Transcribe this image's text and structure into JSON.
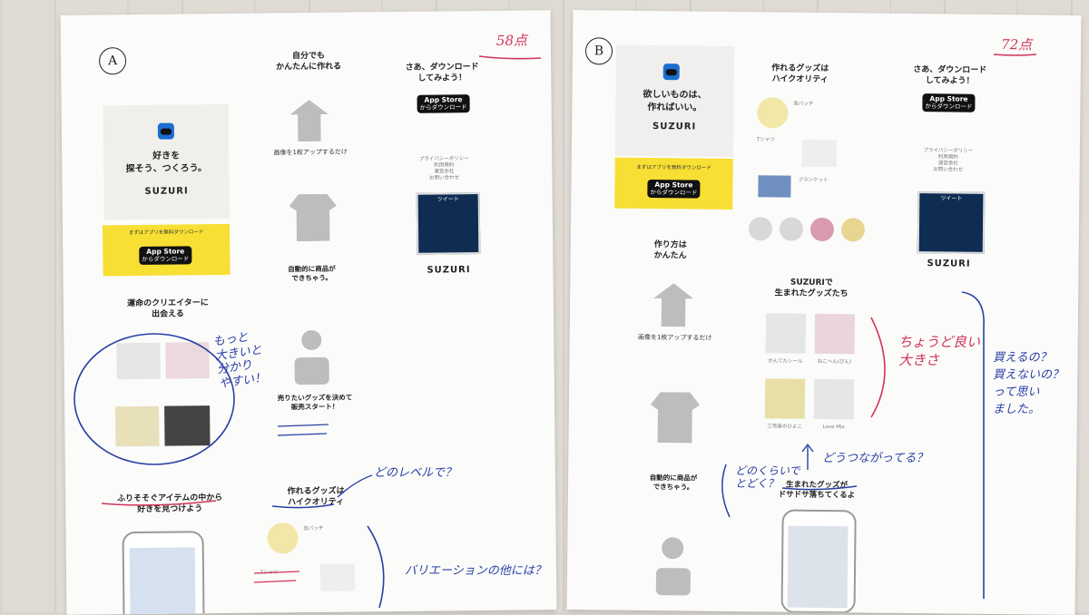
{
  "sheet_a": {
    "label": "A",
    "score": "58点",
    "hero_tagline": "好きを\n探そう、つくろう。",
    "logo": "SUZURI",
    "download_free": "まずはアプリを無料ダウンロード",
    "appstore_line1": "App Store",
    "appstore_line2": "からダウンロード",
    "easy_heading": "自分でも\nかんたんに作れる",
    "step1": "画像を1枚アップするだけ",
    "step2": "自動的に商品が\nできちゃう。",
    "step3": "売りたいグッズを決めて\n販売スタート！",
    "download_heading": "さあ、ダウンロード\nしてみよう！",
    "links": "プライバシーポリシー\n利用規約\n運営会社\nお問い合わせ",
    "tweet_label": "ツイート",
    "creators_heading": "運命のクリエイターに\n出会える",
    "items_heading": "ふりそそぐアイテムの中から\n好きを見つけよう",
    "quality_heading": "作れるグッズは\nハイクオリティ",
    "product1": "缶バッチ",
    "product2": "Tシャツ",
    "note_bigger": "もっと\n大きいと\n分かり\nやすい！",
    "note_level": "どのレベルで？",
    "note_variation": "バリエーションの他には？"
  },
  "sheet_b": {
    "label": "B",
    "score": "72点",
    "hero_tagline": "欲しいものは、\n作ればいい。",
    "logo": "SUZURI",
    "download_free": "まずはアプリを無料ダウンロード",
    "appstore_line1": "App Store",
    "appstore_line2": "からダウンロード",
    "quality_heading": "作れるグッズは\nハイクオリティ",
    "product1": "缶バッチ",
    "product2": "Tシャツ",
    "product3": "ブランケット",
    "download_heading": "さあ、ダウンロード\nしてみよう！",
    "links": "プライバシーポリシー\n利用規約\n運営会社\nお問い合わせ",
    "tweet_label": "ツイート",
    "how_heading": "作り方は\nかんたん",
    "step1": "画像を1枚アップするだけ",
    "step2": "自動的に商品が\nできちゃう。",
    "born_heading": "SUZURIで\n生まれたグッズたち",
    "goods1": "かんてたシール",
    "goods2": "ねこへん(ぴん)",
    "goods3": "三宅泰のひよこ",
    "goods4": "Love Mix",
    "flood_heading": "生まれたグッズが\nドサドサ落ちてくるよ",
    "note_size": "ちょうど良い\n大きさ",
    "note_connect": "どうつながってる？",
    "note_how_much": "どのくらいで\nとどく？",
    "note_buy": "買えるの？\n買えないの？\nって思い\nました。"
  }
}
